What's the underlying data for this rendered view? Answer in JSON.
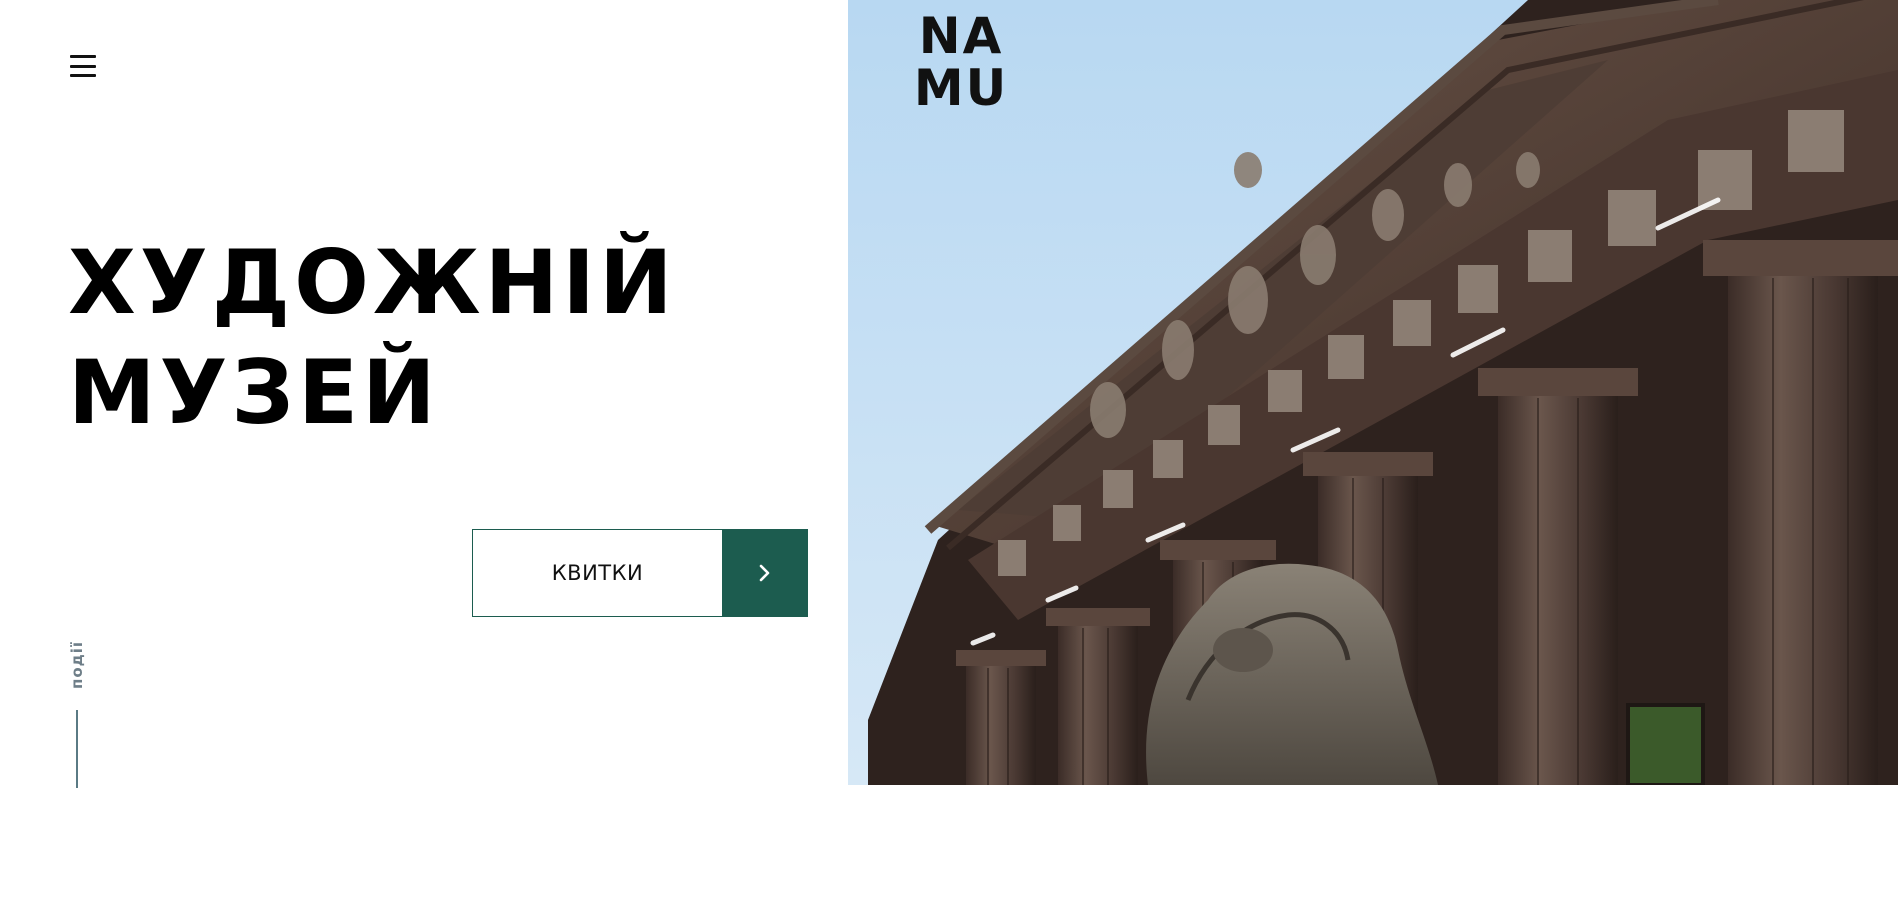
{
  "header": {
    "menu_icon": "hamburger-icon",
    "logo": {
      "line1": "NA",
      "line2": "MU"
    }
  },
  "hero": {
    "title_line1": "ХУДОЖНІЙ",
    "title_line2": "МУЗЕЙ",
    "tickets_label": "КВИТКИ",
    "tickets_arrow_icon": "chevron-right-icon",
    "image_subject": "museum-building-facade-photo"
  },
  "side": {
    "events_label": "події"
  },
  "colors": {
    "accent": "#1c5c4f",
    "text": "#000000",
    "muted": "#6e7e88",
    "background": "#ffffff"
  }
}
